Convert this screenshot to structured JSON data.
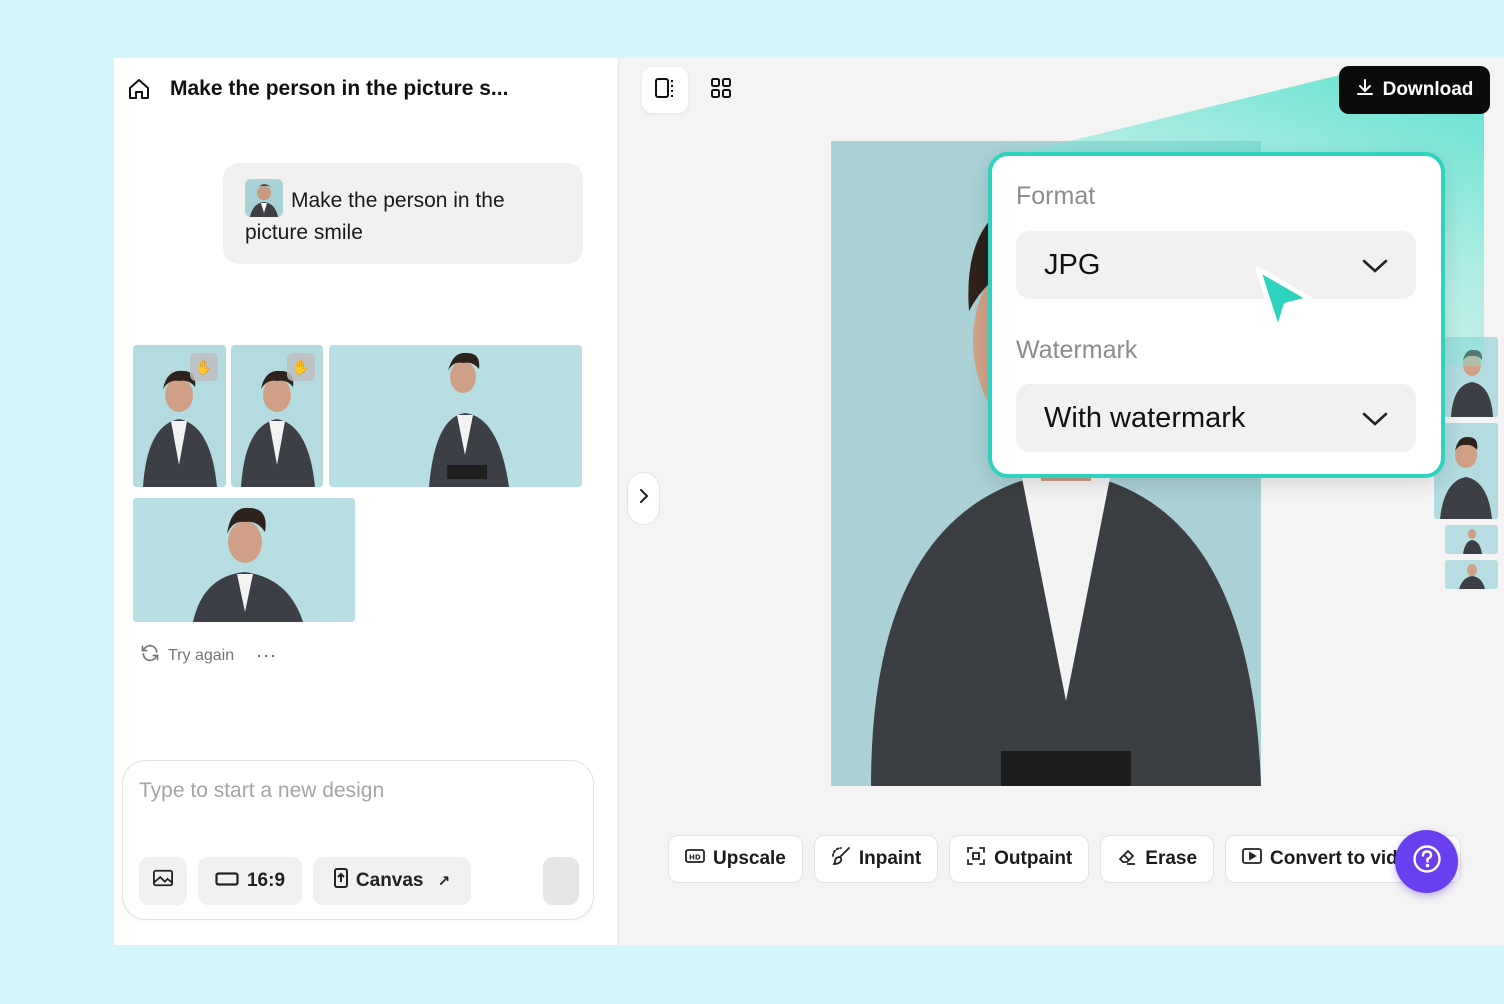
{
  "header": {
    "title": "Make the person in the picture s..."
  },
  "chat": {
    "message": "Make the person in the picture smile",
    "try_again": "Try again",
    "more": "···"
  },
  "composer": {
    "placeholder": "Type to start a new design",
    "ratio_label": "16:9",
    "canvas_label": "Canvas"
  },
  "toolbar": {
    "download_label": "Download"
  },
  "download_popup": {
    "format_label": "Format",
    "format_value": "JPG",
    "watermark_label": "Watermark",
    "watermark_value": "With watermark"
  },
  "tools": {
    "upscale": "Upscale",
    "inpaint": "Inpaint",
    "outpaint": "Outpaint",
    "erase": "Erase",
    "convert": "Convert to vid"
  },
  "colors": {
    "accent": "#2ed3bf",
    "help": "#6a3ff0",
    "download_bg": "#0b0b0b"
  }
}
